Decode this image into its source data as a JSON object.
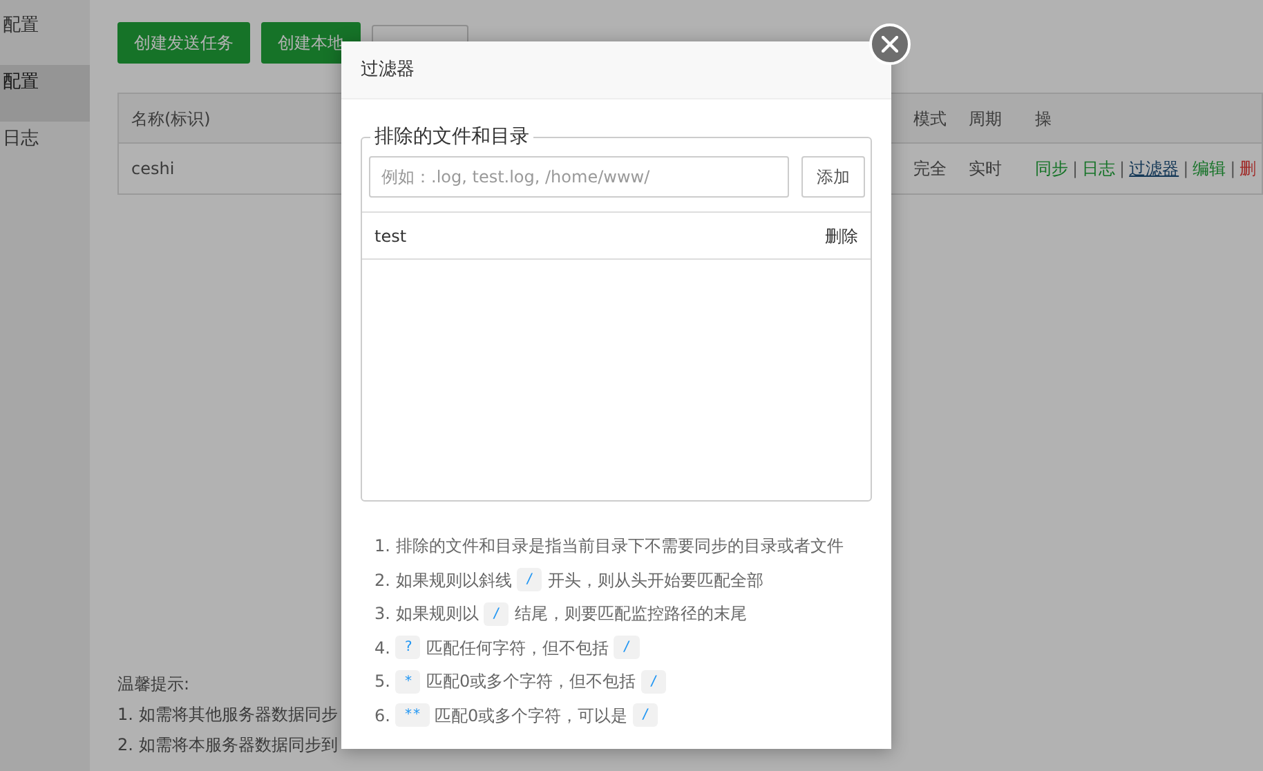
{
  "sidebar": {
    "items": [
      {
        "label": "配置",
        "selected": false
      },
      {
        "label": "配置",
        "selected": true
      },
      {
        "label": "日志",
        "selected": false
      }
    ]
  },
  "toolbar": {
    "buttons": [
      {
        "label": "创建发送任务",
        "kind": "primary"
      },
      {
        "label": "创建本地",
        "kind": "primary"
      },
      {
        "kind": "outline"
      }
    ]
  },
  "table": {
    "columns": [
      "名称(标识)",
      "模式",
      "周期",
      "操"
    ],
    "rows": [
      {
        "name": "ceshi",
        "mode": "完全",
        "period": "实时",
        "separator": "|",
        "actions": [
          {
            "label": "同步",
            "kind": "green"
          },
          {
            "label": "日志",
            "kind": "green"
          },
          {
            "label": "过滤器",
            "kind": "link"
          },
          {
            "label": "编辑",
            "kind": "green"
          },
          {
            "label": "删",
            "kind": "red"
          }
        ]
      }
    ]
  },
  "tips": {
    "title": "温馨提示:",
    "lines": [
      "1. 如需将其他服务器数据同步",
      "2. 如需将本服务器数据同步到"
    ]
  },
  "dialog": {
    "title": "过滤器",
    "legend": "排除的文件和目录",
    "input": {
      "placeholder": "例如：.log, test.log, /home/www/"
    },
    "add_button": "添加",
    "entries": [
      {
        "path": "test",
        "action": "删除"
      }
    ],
    "notes": [
      [
        {
          "kind": "text",
          "text": "1. 排除的文件和目录是指当前目录下不需要同步的目录或者文件"
        }
      ],
      [
        {
          "kind": "text",
          "text": "2. 如果规则以斜线"
        },
        {
          "kind": "code",
          "text": "/"
        },
        {
          "kind": "text",
          "text": "开头，则从头开始要匹配全部"
        }
      ],
      [
        {
          "kind": "text",
          "text": "3. 如果规则以"
        },
        {
          "kind": "code",
          "text": "/"
        },
        {
          "kind": "text",
          "text": "结尾，则要匹配监控路径的末尾"
        }
      ],
      [
        {
          "kind": "text",
          "text": "4."
        },
        {
          "kind": "code",
          "text": "?"
        },
        {
          "kind": "text",
          "text": "匹配任何字符，但不包括"
        },
        {
          "kind": "code",
          "text": "/"
        }
      ],
      [
        {
          "kind": "text",
          "text": "5."
        },
        {
          "kind": "code",
          "text": "*"
        },
        {
          "kind": "text",
          "text": "匹配0或多个字符，但不包括"
        },
        {
          "kind": "code",
          "text": "/"
        }
      ],
      [
        {
          "kind": "text",
          "text": "6."
        },
        {
          "kind": "code",
          "text": "**"
        },
        {
          "kind": "text",
          "text": "匹配0或多个字符，可以是"
        },
        {
          "kind": "code",
          "text": "/"
        }
      ]
    ]
  }
}
